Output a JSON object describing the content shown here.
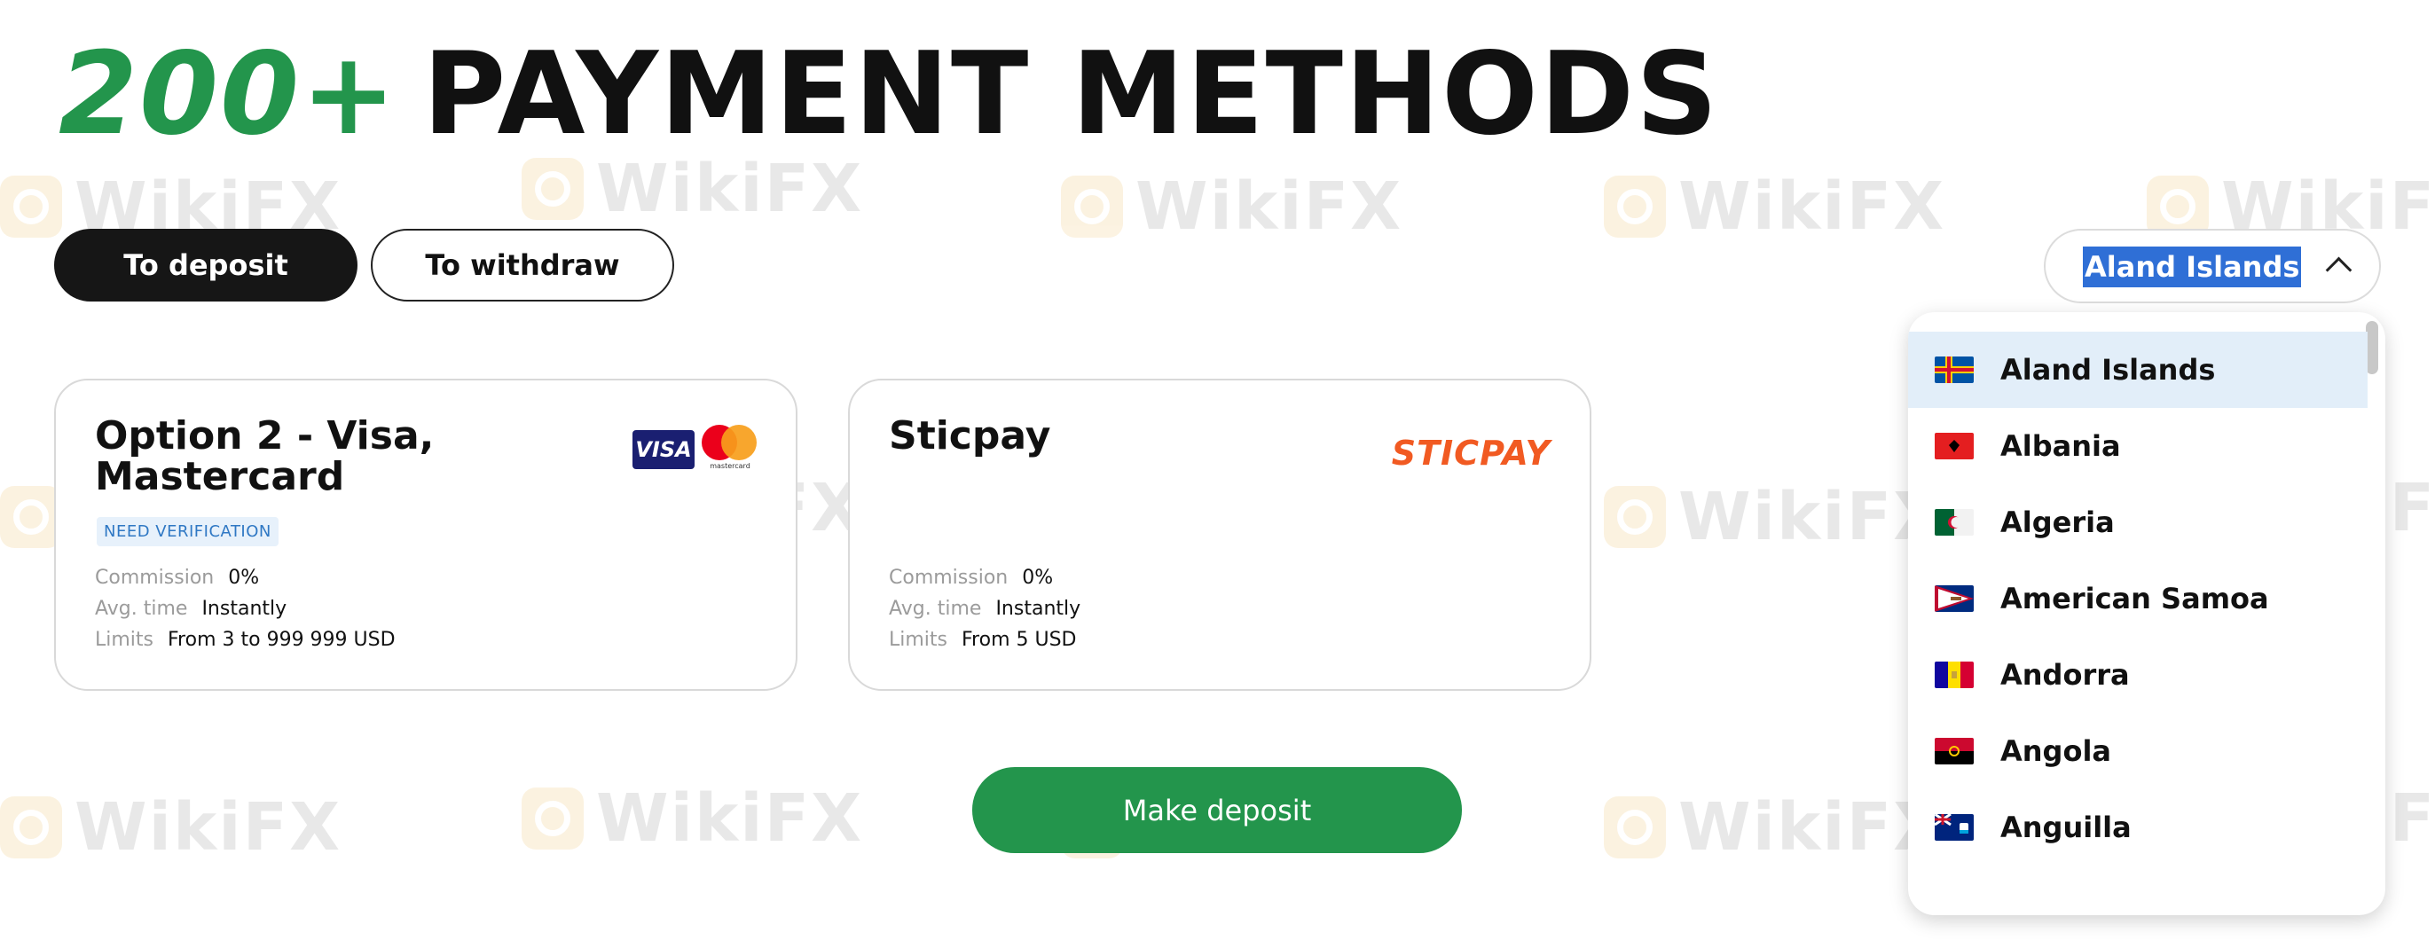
{
  "header": {
    "title_accent": "200+",
    "title_rest": "PAYMENT METHODS"
  },
  "tabs": {
    "deposit": "To deposit",
    "withdraw": "To withdraw"
  },
  "watermark_text": "WikiFX",
  "cards": [
    {
      "name": "Option 2 - Visa, Mastercard",
      "badge": "NEED VERIFICATION",
      "commission_label": "Commission",
      "commission": "0%",
      "time_label": "Avg. time",
      "time": "Instantly",
      "limits_label": "Limits",
      "limits": "From 3 to 999 999 USD",
      "logos": {
        "visa": "VISA",
        "mastercard": "mastercard"
      }
    },
    {
      "name": "Sticpay",
      "commission_label": "Commission",
      "commission": "0%",
      "time_label": "Avg. time",
      "time": "Instantly",
      "limits_label": "Limits",
      "limits": "From 5 USD",
      "logo": "STICPAY"
    }
  ],
  "cta": {
    "deposit": "Make deposit"
  },
  "country_selector": {
    "selected": "Aland Islands",
    "icon": "chevron-up-icon"
  },
  "countries": [
    {
      "name": "Aland Islands",
      "flag": "aland-flag"
    },
    {
      "name": "Albania",
      "flag": "albania-flag"
    },
    {
      "name": "Algeria",
      "flag": "algeria-flag"
    },
    {
      "name": "American Samoa",
      "flag": "american-samoa-flag"
    },
    {
      "name": "Andorra",
      "flag": "andorra-flag"
    },
    {
      "name": "Angola",
      "flag": "angola-flag"
    },
    {
      "name": "Anguilla",
      "flag": "anguilla-flag"
    }
  ],
  "colors": {
    "accent_green": "#23954c",
    "selection_blue": "#2f6fd6",
    "sticpay_orange": "#f15a22"
  }
}
